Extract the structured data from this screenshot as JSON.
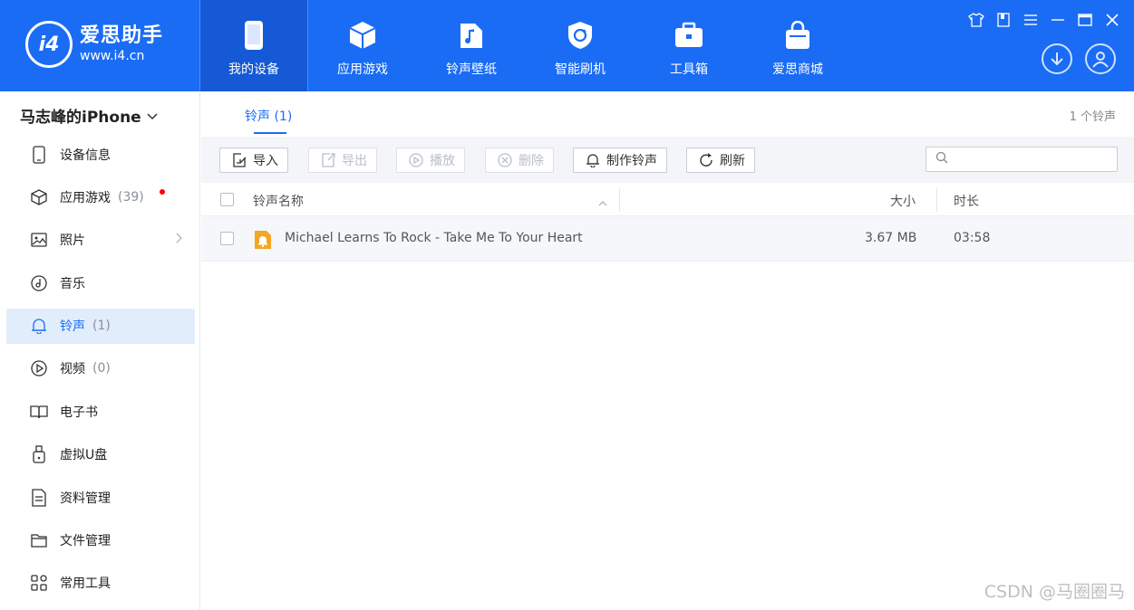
{
  "brand": {
    "name": "爱思助手",
    "url": "www.i4.cn",
    "logo_text": "i4"
  },
  "nav": [
    {
      "label": "我的设备",
      "icon": "phone-icon",
      "active": true
    },
    {
      "label": "应用游戏",
      "icon": "cube-icon",
      "active": false
    },
    {
      "label": "铃声壁纸",
      "icon": "music-file-icon",
      "active": false
    },
    {
      "label": "智能刷机",
      "icon": "shield-refresh-icon",
      "active": false
    },
    {
      "label": "工具箱",
      "icon": "toolbox-icon",
      "active": false
    },
    {
      "label": "爱思商城",
      "icon": "shopping-bag-icon",
      "active": false
    }
  ],
  "window_controls": [
    "shirt-icon",
    "book-icon",
    "menu-icon",
    "minimize-icon",
    "maximize-icon",
    "close-icon"
  ],
  "device": {
    "name": "马志峰的iPhone"
  },
  "sidebar": {
    "items": [
      {
        "label": "设备信息",
        "count": "",
        "icon": "device-info-icon"
      },
      {
        "label": "应用游戏",
        "count": "(39)",
        "icon": "app-cube-icon",
        "badge": true
      },
      {
        "label": "照片",
        "count": "",
        "icon": "photo-icon",
        "chevron": true
      },
      {
        "label": "音乐",
        "count": "",
        "icon": "music-icon"
      },
      {
        "label": "铃声",
        "count": "(1)",
        "icon": "bell-icon",
        "active": true
      },
      {
        "label": "视频",
        "count": "(0)",
        "icon": "video-icon"
      },
      {
        "label": "电子书",
        "count": "",
        "icon": "ebook-icon"
      },
      {
        "label": "虚拟U盘",
        "count": "",
        "icon": "usb-icon"
      },
      {
        "label": "资料管理",
        "count": "",
        "icon": "document-icon"
      },
      {
        "label": "文件管理",
        "count": "",
        "icon": "folder-icon"
      },
      {
        "label": "常用工具",
        "count": "",
        "icon": "tools-grid-icon"
      }
    ]
  },
  "main": {
    "tab_label": "铃声 (1)",
    "count_label": "1 个铃声",
    "toolbar": {
      "import": "导入",
      "export": "导出",
      "play": "播放",
      "delete": "删除",
      "make_ringtone": "制作铃声",
      "refresh": "刷新"
    },
    "search": {
      "placeholder": ""
    },
    "columns": {
      "name": "铃声名称",
      "size": "大小",
      "duration": "时长"
    },
    "rows": [
      {
        "name": "Michael Learns To Rock - Take Me To Your Heart",
        "size": "3.67 MB",
        "duration": "03:58"
      }
    ]
  },
  "watermark": "CSDN @马圈圈马",
  "colors": {
    "accent": "#1a6cf5",
    "sidebar_active_bg": "#e2edfc",
    "ringtone_icon": "#f5a623"
  }
}
